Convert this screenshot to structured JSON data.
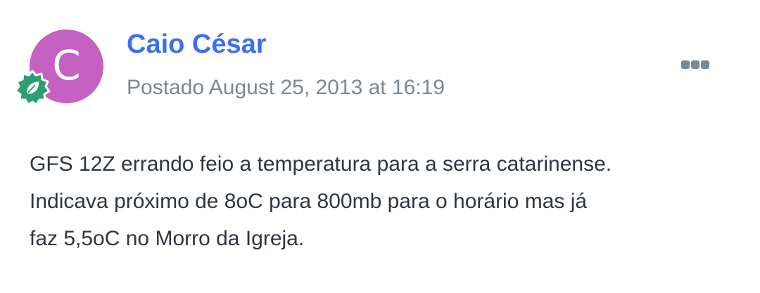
{
  "post": {
    "author": {
      "name": "Caio César",
      "avatar_letter": "C",
      "avatar_color": "#c561c1",
      "name_color": "#3b6ef1",
      "badge_icon": "leaf-badge-icon",
      "badge_color": "#2e9d73"
    },
    "meta": {
      "posted_text": "Postado August 25, 2013 at 16:19",
      "color": "#7b8794"
    },
    "menu": {
      "icon": "ellipsis-icon",
      "color": "#7b8794"
    },
    "body": {
      "lines": [
        "GFS 12Z errando feio a temperatura para a serra catarinense.",
        "Indicava próximo de 8oC para 800mb para o horário mas já",
        "faz 5,5oC no Morro da Igreja."
      ],
      "color": "#2f3640"
    }
  }
}
